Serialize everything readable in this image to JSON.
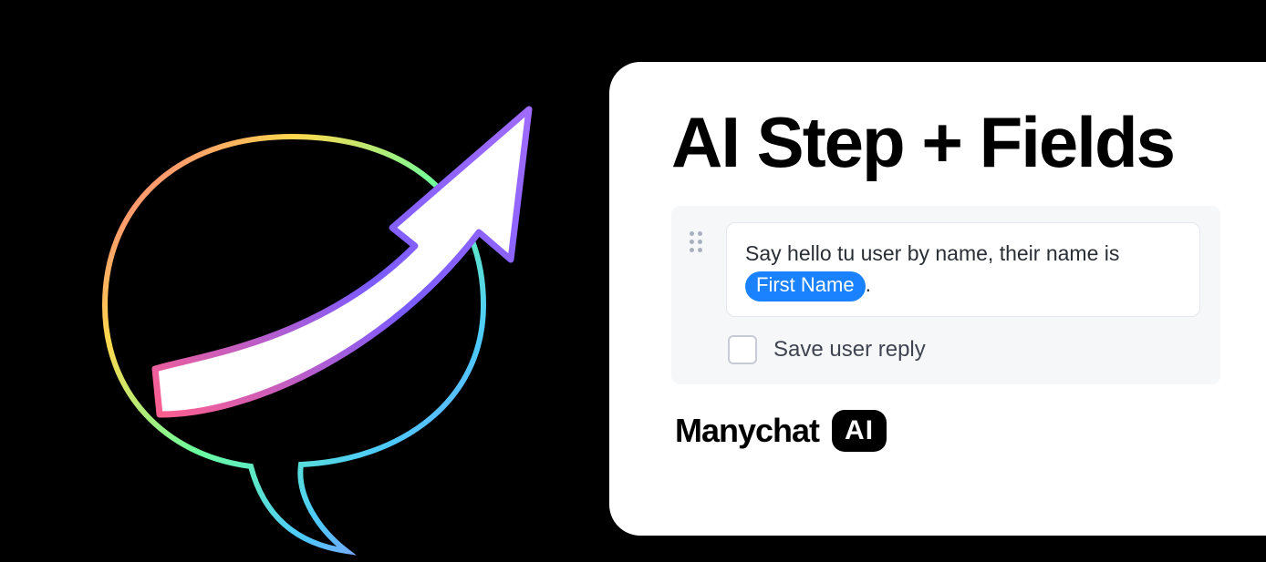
{
  "card": {
    "title": "AI Step + Fields",
    "prompt_prefix": "Say hello tu user by name, their name is ",
    "field_chip": "First Name",
    "prompt_suffix": ".",
    "save_label": "Save user reply"
  },
  "brand": {
    "name": "Manychat",
    "badge": "AI"
  }
}
